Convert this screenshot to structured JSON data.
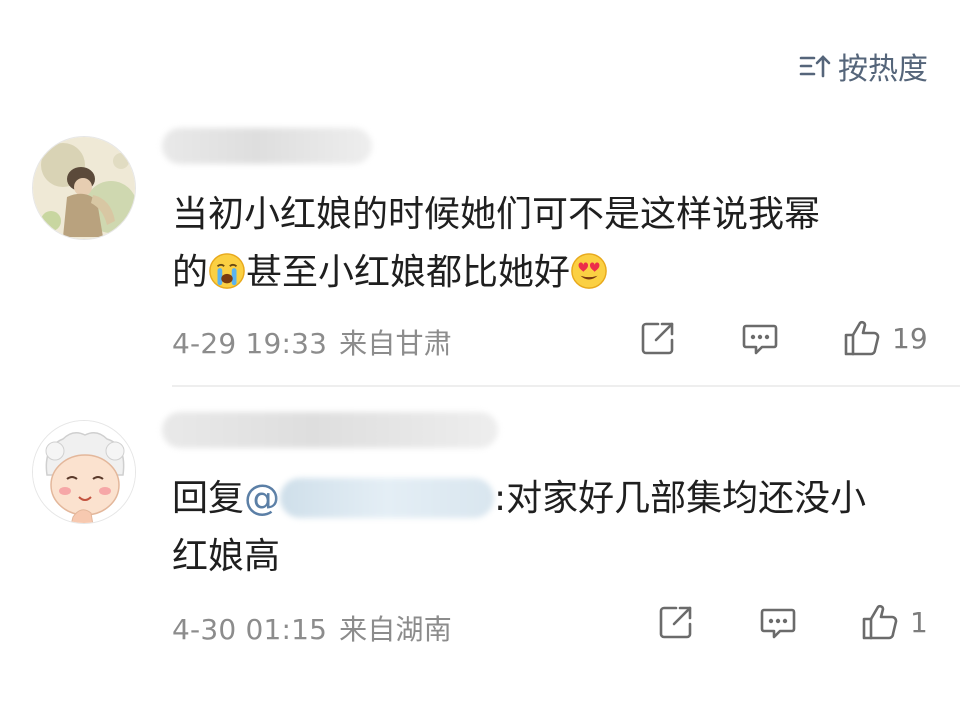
{
  "sort": {
    "label": "按热度"
  },
  "comments": [
    {
      "text_line1": "当初小红娘的时候她们可不是这样说我幂",
      "text_line2_a": "的",
      "text_line2_b": "甚至小红娘都比她好",
      "emoji_a": "loudly-crying-face",
      "emoji_b": "smiling-face-with-heart-eyes",
      "time": "4-29 19:33",
      "location": "来自甘肃",
      "likes": "19"
    },
    {
      "reply_prefix": "回复",
      "reply_at": "@",
      "text_after_mention": ":对家好几部集均还没小",
      "text_line2": "红娘高",
      "time": "4-30 01:15",
      "location": "来自湖南",
      "likes": "1"
    }
  ],
  "colors": {
    "meta": "#8c8c8c",
    "icon": "#6b6b6b",
    "sort": "#55657a",
    "mention": "#5b7fa6"
  }
}
